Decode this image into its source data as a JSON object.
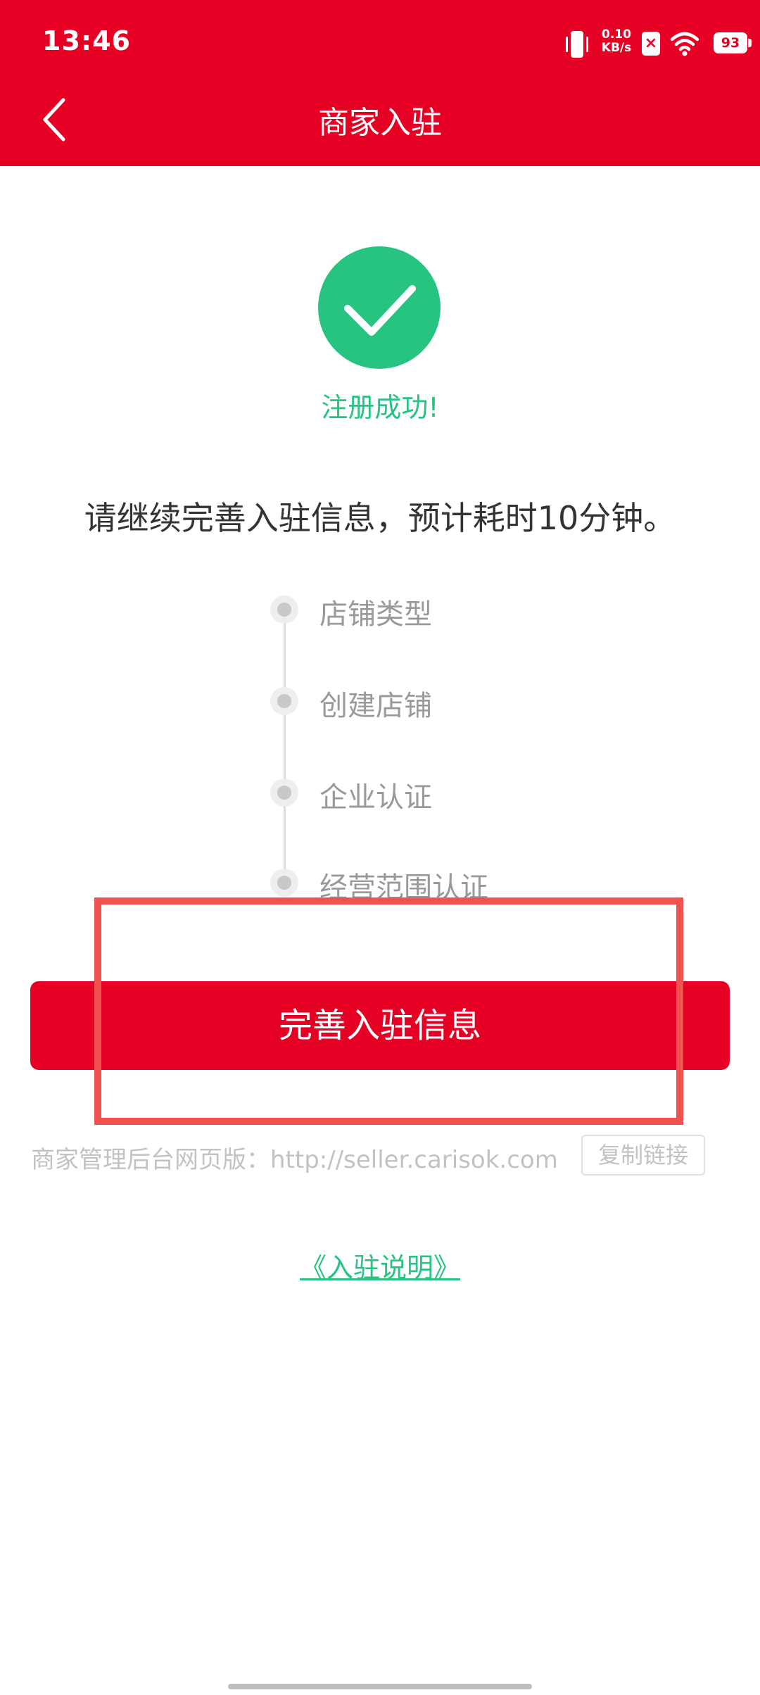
{
  "status_bar": {
    "time": "13:46",
    "net_speed_value": "0.10",
    "net_speed_unit": "KB/s",
    "battery": "93",
    "icons": [
      "vibrate-icon",
      "sim-x-icon",
      "wifi-icon",
      "battery-icon"
    ]
  },
  "nav": {
    "title": "商家入驻",
    "back_icon": "chevron-left-icon"
  },
  "success": {
    "icon": "check-circle-icon",
    "text": "注册成功!"
  },
  "subtitle": "请继续完善入驻信息，预计耗时10分钟。",
  "steps": [
    {
      "label": "店铺类型"
    },
    {
      "label": "创建店铺"
    },
    {
      "label": "企业认证"
    },
    {
      "label": "经营范围认证"
    }
  ],
  "primary_button": {
    "label": "完善入驻信息"
  },
  "backend": {
    "label": "商家管理后台网页版：http://seller.carisok.com",
    "copy_button": "复制链接"
  },
  "guide_link": "《入驻说明》",
  "colors": {
    "brand_red": "#e60023",
    "success_green": "#27c380",
    "highlight_red": "#f0524f"
  }
}
